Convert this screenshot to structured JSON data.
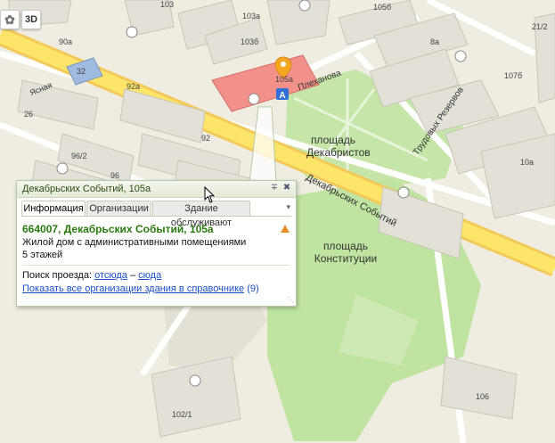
{
  "controls": {
    "logo_icon": "map-provider-logo",
    "mode_3d_label": "3D"
  },
  "map": {
    "building_numbers": [
      "103",
      "103а",
      "103б",
      "105б",
      "90а",
      "32",
      "92а",
      "26",
      "92",
      "96/2",
      "96",
      "8а",
      "21/2",
      "107б",
      "10а",
      "105а",
      "106",
      "102/1"
    ],
    "streets": {
      "yasnaya": "Ясная",
      "plehanova": "Плеханова",
      "trudovyh_rezervov": "Трудовых Резервов",
      "dekabrskih_sobytiy": "Декабрьских Событий"
    },
    "places": {
      "decembrists_square": "площадь Декабристов",
      "constitution_square": "площадь Конституции"
    },
    "marker_letter": "A",
    "marker_label": "105а"
  },
  "balloon": {
    "title": "Декабрьских Событий, 105а",
    "tabs": [
      "Информация",
      "Организации",
      "Здание обслуживают"
    ],
    "active_tab": "Информация",
    "address": "664007, Декабрьских Событий, 105а",
    "description_line1": "Жилой дом с административными помещениями",
    "description_line2": "5 этажей",
    "route_label": "Поиск проезда:",
    "route_from": "отсюда",
    "route_dash": "–",
    "route_to": "сюда",
    "show_all_link": "Показать все организации здания в справочнике",
    "show_all_count": "(9)"
  }
}
